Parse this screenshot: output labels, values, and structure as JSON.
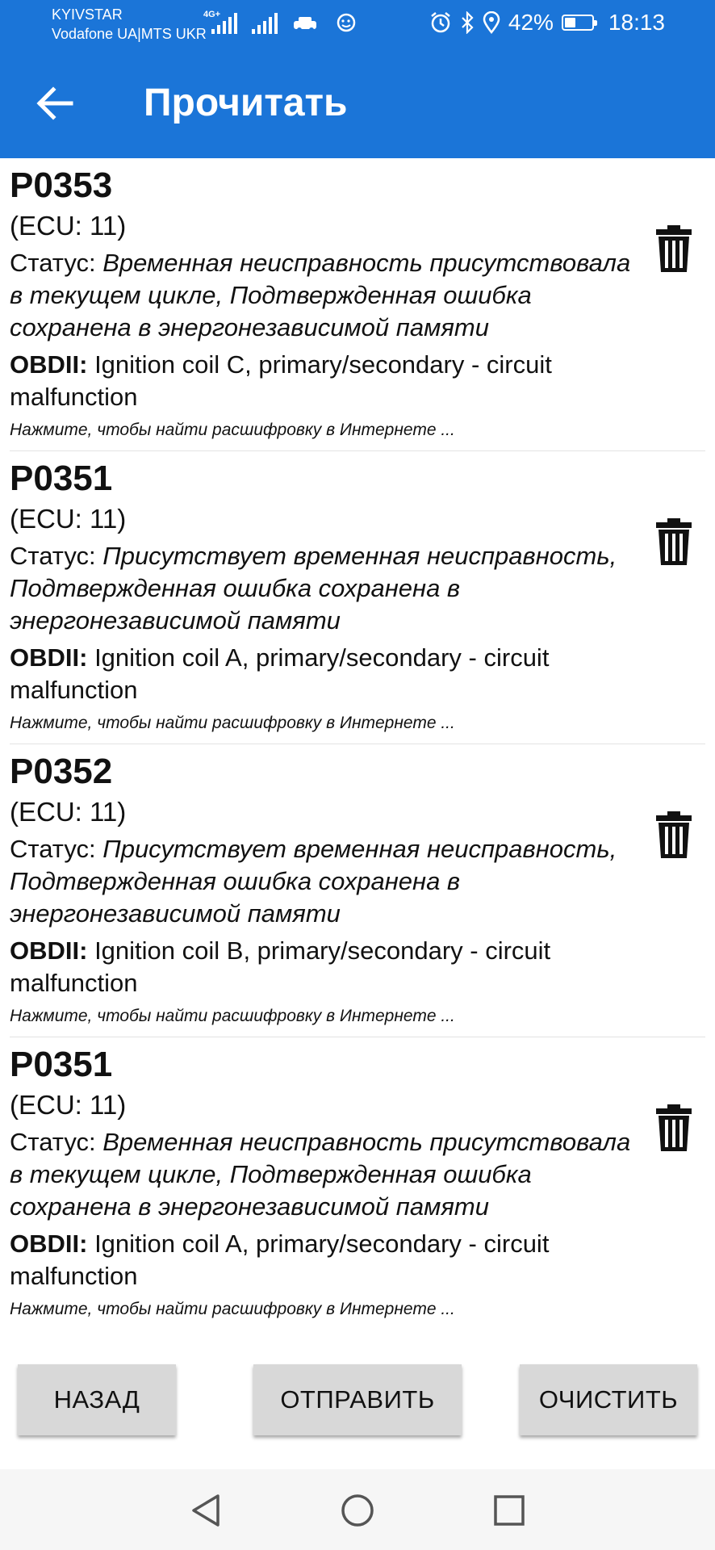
{
  "status_bar": {
    "carrier1": "KYIVSTAR",
    "carrier2": "Vodafone UA|MTS UKR",
    "network": "4G+",
    "battery_percent": "42%",
    "battery_level": 0.42,
    "time": "18:13",
    "icons": [
      "signal-icon",
      "car-icon",
      "waze-icon",
      "alarm-icon",
      "bluetooth-icon",
      "location-icon",
      "battery-icon"
    ]
  },
  "app_bar": {
    "title": "Прочитать",
    "back_icon": "arrow-left-icon"
  },
  "dtc_list": [
    {
      "code": "P0353",
      "ecu": "(ECU: 11)",
      "status_label": "Статус:",
      "status_value": "Временная неисправность присутствовала в текущем цикле, Подтвержденная ошибка сохранена в энергонезависимой памяти",
      "obd_label": "OBDII:",
      "obd_value": "Ignition coil C, primary/secondary - circuit malfunction",
      "hint": "Нажмите, чтобы найти расшифровку в Интернете ..."
    },
    {
      "code": "P0351",
      "ecu": "(ECU: 11)",
      "status_label": "Статус:",
      "status_value": "Присутствует временная неисправность, Подтвержденная ошибка сохранена в энергонезависимой памяти",
      "obd_label": "OBDII:",
      "obd_value": "Ignition coil A, primary/secondary - circuit malfunction",
      "hint": "Нажмите, чтобы найти расшифровку в Интернете ..."
    },
    {
      "code": "P0352",
      "ecu": "(ECU: 11)",
      "status_label": "Статус:",
      "status_value": "Присутствует временная неисправность, Подтвержденная ошибка сохранена в энергонезависимой памяти",
      "obd_label": "OBDII:",
      "obd_value": "Ignition coil B, primary/secondary - circuit malfunction",
      "hint": "Нажмите, чтобы найти расшифровку в Интернете ..."
    },
    {
      "code": "P0351",
      "ecu": "(ECU: 11)",
      "status_label": "Статус:",
      "status_value": "Временная неисправность присутствовала в текущем цикле, Подтвержденная ошибка сохранена в энергонезависимой памяти",
      "obd_label": "OBDII:",
      "obd_value": "Ignition coil A, primary/secondary - circuit malfunction",
      "hint": "Нажмите, чтобы найти расшифровку в Интернете ..."
    }
  ],
  "buttons": {
    "back": "НАЗАД",
    "send": "ОТПРАВИТЬ",
    "clear": "ОЧИСТИТЬ"
  },
  "nav_bar": {
    "icons": [
      "nav-back-icon",
      "nav-home-icon",
      "nav-recents-icon"
    ]
  },
  "colors": {
    "primary": "#1b75d8",
    "button_bg": "#d8d8d8"
  }
}
